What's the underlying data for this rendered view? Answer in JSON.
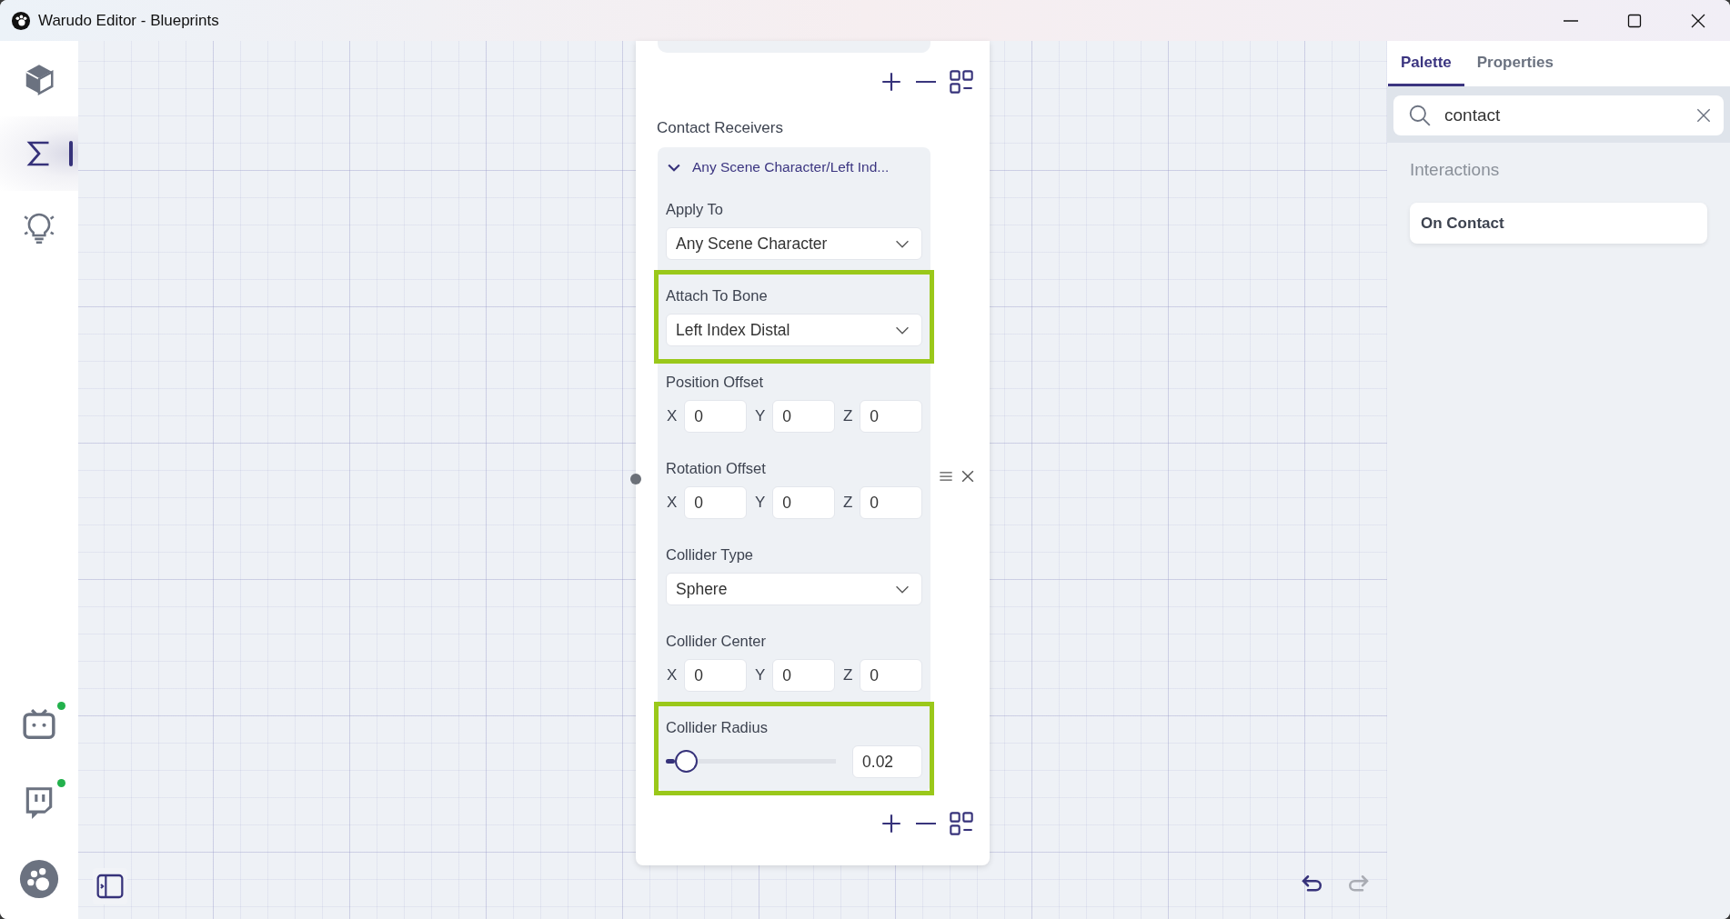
{
  "window": {
    "title": "Warudo Editor - Blueprints"
  },
  "sidebar": {
    "items": [
      {
        "kind": "scene",
        "selected": false
      },
      {
        "kind": "blueprints",
        "selected": true
      },
      {
        "kind": "ideas",
        "selected": false
      }
    ],
    "services": [
      {
        "kind": "bilibili",
        "online": true
      },
      {
        "kind": "twitch",
        "online": true
      },
      {
        "kind": "logo"
      }
    ]
  },
  "node": {
    "section_title": "Contact Receivers",
    "receiver": {
      "title": "Any Scene Character/Left Ind...",
      "expanded": true,
      "fields": [
        {
          "kind": "select",
          "label": "Apply To",
          "value": "Any Scene Character",
          "highlighted": false
        },
        {
          "kind": "select",
          "label": "Attach To Bone",
          "value": "Left Index Distal",
          "highlighted": true
        },
        {
          "kind": "vector3",
          "label": "Position Offset",
          "axes": [
            {
              "axis": "X",
              "value": "0"
            },
            {
              "axis": "Y",
              "value": "0"
            },
            {
              "axis": "Z",
              "value": "0"
            }
          ],
          "highlighted": false
        },
        {
          "kind": "vector3",
          "label": "Rotation Offset",
          "axes": [
            {
              "axis": "X",
              "value": "0"
            },
            {
              "axis": "Y",
              "value": "0"
            },
            {
              "axis": "Z",
              "value": "0"
            }
          ],
          "highlighted": false
        },
        {
          "kind": "select",
          "label": "Collider Type",
          "value": "Sphere",
          "highlighted": false
        },
        {
          "kind": "vector3",
          "label": "Collider Center",
          "axes": [
            {
              "axis": "X",
              "value": "0"
            },
            {
              "axis": "Y",
              "value": "0"
            },
            {
              "axis": "Z",
              "value": "0"
            }
          ],
          "highlighted": false
        },
        {
          "kind": "slider",
          "label": "Collider Radius",
          "level": 0.05,
          "value": "0.02",
          "highlighted": true
        }
      ]
    }
  },
  "canvas": {
    "undo": {
      "disabled": false
    },
    "redo": {
      "disabled": true
    }
  },
  "palette": {
    "tabs": [
      {
        "label": "Palette",
        "selected": true
      },
      {
        "label": "Properties",
        "selected": false
      }
    ],
    "search": {
      "value": "contact"
    },
    "groups": [
      {
        "title": "Interactions",
        "items": [
          "On Contact"
        ]
      }
    ]
  }
}
